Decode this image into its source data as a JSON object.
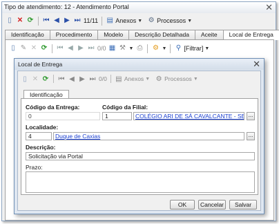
{
  "window": {
    "title": "Tipo de atendimento: 12 - Atendimento Portal"
  },
  "toolbar": {
    "counter": "11/11",
    "anexos": "Anexos",
    "processos": "Processos"
  },
  "tabs": [
    "Identificação",
    "Procedimento",
    "Modelo",
    "Descrição Detalhada",
    "Aceite",
    "Local de Entrega"
  ],
  "subtoolbar": {
    "counter": "0/0",
    "filtrar": "[Filtrar]"
  },
  "dialog": {
    "title": "Local de Entrega",
    "toolbar": {
      "counter": "0/0",
      "anexos": "Anexos",
      "processos": "Processos"
    },
    "tab": "Identificação",
    "codigo_entrega": {
      "label": "Código da Entrega:",
      "value": "0"
    },
    "codigo_filial": {
      "label": "Código da Filial:",
      "value": "1",
      "link": "COLÉGIO ARI DE SÁ CAVALCANTE - SEDE WASHINGTON SO"
    },
    "localidade": {
      "label": "Localidade:",
      "value": "4",
      "link": "Duque de Caxias"
    },
    "descricao": {
      "label": "Descrição:",
      "value": "Solicitação via Portal"
    },
    "prazo": {
      "label": "Prazo:",
      "value": ""
    },
    "buttons": {
      "ok": "OK",
      "cancelar": "Cancelar",
      "salvar": "Salvar"
    }
  }
}
